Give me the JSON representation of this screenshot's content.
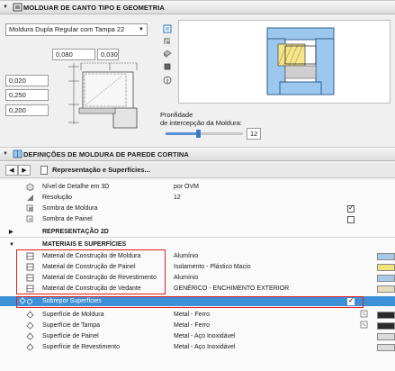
{
  "geometry_panel": {
    "title": "MOLDUAR DE CANTO TIPO E GEOMETRIA",
    "profile_select": "Moldura Dupla Regular com Tampa 22",
    "width_a": "0,080",
    "width_b": "0,030",
    "dim_1": "0,020",
    "dim_2": "0,250",
    "dim_3": "0,200",
    "depth_label_line1": "Pronfidade",
    "depth_label_line2": "de intercepção da Moldura:",
    "depth_value": "12",
    "depth_slider_fraction": 0.42
  },
  "settings_panel": {
    "title": "DEFINIÇÕES DE MOLDURA DE PAREDE CORTINA",
    "nav_label": "Representação e Superfícies..."
  },
  "rows": [
    {
      "label": "Nível de Detalhe em 3D",
      "value": "por OVM"
    },
    {
      "label": "Resolução",
      "value": "12"
    },
    {
      "label": "Sombra de Moldura",
      "value": "",
      "checked": true
    },
    {
      "label": "Sombra de Painel",
      "value": "",
      "checked": false
    }
  ],
  "section_2d": {
    "title": "REPRESENTAÇÃO 2D"
  },
  "section_materials": {
    "title": "MATERIAIS E SUPERFÍCIES"
  },
  "material_rows": [
    {
      "label": "Material de Construção de Moldura",
      "value": "Alumínio",
      "swatch": "#a8c8e8"
    },
    {
      "label": "Material de Construção de Painel",
      "value": "Isolamento - Plástico Macio",
      "swatch": "#f2e27a"
    },
    {
      "label": "Material de Construção de Revestimento",
      "value": "Alumínio",
      "swatch": "#a8c8e8"
    },
    {
      "label": "Material de Construção de Vedante",
      "value": "GENÉRICO - ENCHIMENTO EXTERIOR",
      "swatch": "#e8dcc0"
    }
  ],
  "override_row": {
    "label": "Sobrepor Superfícies",
    "checked": true
  },
  "surface_rows": [
    {
      "label": "Superfície de Moldura",
      "value": "Metal - Ferro"
    },
    {
      "label": "Superfície de Tampa",
      "value": "Metal - Ferro"
    },
    {
      "label": "Superfície de Painel",
      "value": "Metal - Aço Inoxidável"
    },
    {
      "label": "Superfície de Revestimento",
      "value": "Metal - Aço Inoxidável"
    }
  ],
  "colors": {
    "highlight_row": "#3d8fd6",
    "selection_border": "#e02020",
    "preview_blue": "#9cc7ee",
    "preview_yellow": "#f4e48a"
  }
}
